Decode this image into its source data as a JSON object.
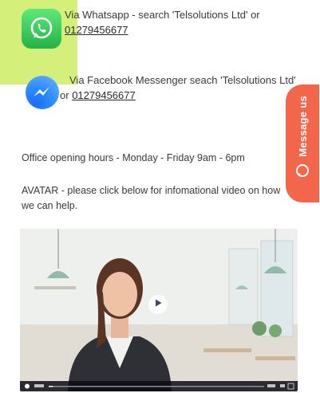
{
  "contacts": {
    "whatsapp": {
      "text": "Via Whatsapp - search 'Telsolutions Ltd' or",
      "phone": "01279456677",
      "icon": "whatsapp-icon"
    },
    "facebook": {
      "text": "Via Facebook Messenger seach 'Telsolutions Ltd' or",
      "phone": "01279456677",
      "icon": "messenger-icon"
    }
  },
  "hours": "Office opening hours - Monday - Friday 9am - 6pm",
  "avatar_text": "AVATAR - please click below for infomational video on how we can help.",
  "message_tab": {
    "label": "Message us",
    "icon": "chat-bubble-icon"
  },
  "colors": {
    "accent_block": "#d4f07a",
    "whatsapp_green": "#25c24f",
    "messenger_blue": "#2c8dff",
    "message_tab": "#f2664c"
  },
  "video": {
    "play_icon": "play-icon",
    "progress": 0.02
  }
}
